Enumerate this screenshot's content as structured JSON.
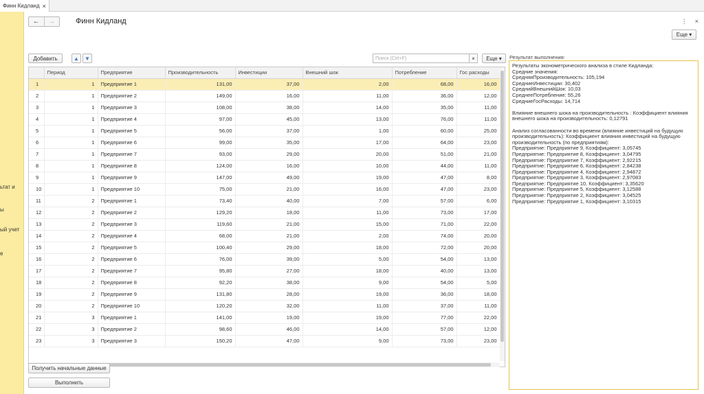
{
  "tab": {
    "title": "Финн Кидланд"
  },
  "left_panel": {
    "items": [
      "ьтат и",
      "ы",
      "ый учет",
      "е"
    ]
  },
  "header": {
    "title": "Финн Кидланд",
    "more_label": "Еще ▾",
    "kebab": "⋮",
    "close": "×"
  },
  "toolbar": {
    "add_label": "Добавить",
    "up_arrow": "▲",
    "down_arrow": "▼",
    "search_placeholder": "Поиск (Ctrl+F)",
    "search_clear": "×",
    "more_label": "Еще ▾"
  },
  "table": {
    "columns": [
      "",
      "Период",
      "Предприятие",
      "Производительность",
      "Инвестиции",
      "Внешний шок",
      "Потребление",
      "Гос расходы"
    ],
    "rows": [
      [
        "1",
        "1",
        "Предприятие 1",
        "131,00",
        "37,00",
        "2,00",
        "68,00",
        "16,00"
      ],
      [
        "2",
        "1",
        "Предприятие 2",
        "149,00",
        "16,00",
        "11,00",
        "36,00",
        "12,00"
      ],
      [
        "3",
        "1",
        "Предприятие 3",
        "108,00",
        "38,00",
        "14,00",
        "35,00",
        "11,00"
      ],
      [
        "4",
        "1",
        "Предприятие 4",
        "97,00",
        "45,00",
        "13,00",
        "76,00",
        "11,00"
      ],
      [
        "5",
        "1",
        "Предприятие 5",
        "56,00",
        "37,00",
        "1,00",
        "60,00",
        "25,00"
      ],
      [
        "6",
        "1",
        "Предприятие 6",
        "99,00",
        "35,00",
        "17,00",
        "64,00",
        "23,00"
      ],
      [
        "7",
        "1",
        "Предприятие 7",
        "93,00",
        "29,00",
        "20,00",
        "51,00",
        "21,00"
      ],
      [
        "8",
        "1",
        "Предприятие 8",
        "124,00",
        "16,00",
        "10,00",
        "44,00",
        "11,00"
      ],
      [
        "9",
        "1",
        "Предприятие 9",
        "147,00",
        "49,00",
        "19,00",
        "47,00",
        "8,00"
      ],
      [
        "10",
        "1",
        "Предприятие 10",
        "75,00",
        "21,00",
        "16,00",
        "47,00",
        "23,00"
      ],
      [
        "11",
        "2",
        "Предприятие 1",
        "73,40",
        "40,00",
        "7,00",
        "57,00",
        "6,00"
      ],
      [
        "12",
        "2",
        "Предприятие 2",
        "129,20",
        "18,00",
        "11,00",
        "73,00",
        "17,00"
      ],
      [
        "13",
        "2",
        "Предприятие 3",
        "119,60",
        "21,00",
        "15,00",
        "71,00",
        "22,00"
      ],
      [
        "14",
        "2",
        "Предприятие 4",
        "68,00",
        "21,00",
        "2,00",
        "74,00",
        "20,00"
      ],
      [
        "15",
        "2",
        "Предприятие 5",
        "100,40",
        "29,00",
        "18,00",
        "72,00",
        "20,00"
      ],
      [
        "16",
        "2",
        "Предприятие 6",
        "76,00",
        "39,00",
        "5,00",
        "54,00",
        "13,00"
      ],
      [
        "17",
        "2",
        "Предприятие 7",
        "95,80",
        "27,00",
        "18,00",
        "40,00",
        "13,00"
      ],
      [
        "18",
        "2",
        "Предприятие 8",
        "92,20",
        "38,00",
        "9,00",
        "54,00",
        "5,00"
      ],
      [
        "19",
        "2",
        "Предприятие 9",
        "131,80",
        "28,00",
        "19,00",
        "36,00",
        "18,00"
      ],
      [
        "20",
        "2",
        "Предприятие 10",
        "120,20",
        "32,00",
        "11,00",
        "37,00",
        "11,00"
      ],
      [
        "21",
        "3",
        "Предприятие 1",
        "141,00",
        "19,00",
        "19,00",
        "77,00",
        "22,00"
      ],
      [
        "22",
        "3",
        "Предприятие 2",
        "98,60",
        "46,00",
        "14,00",
        "57,00",
        "12,00"
      ],
      [
        "23",
        "3",
        "Предприятие 3",
        "150,20",
        "47,00",
        "9,00",
        "73,00",
        "23,00"
      ]
    ]
  },
  "buttons": {
    "get_data_label": "Получить начальные данные",
    "execute_label": "Выполнить"
  },
  "result": {
    "label": "Результат выполнения:",
    "lines": [
      "Результаты эконометрического анализа в стиле Кидланда:",
      "Средние значения:",
      "СредняяПроизводительность: 105,194",
      "СредниеИнвестиции: 30,402",
      "СреднийВнешнийШок: 10,03",
      "СреднееПотребление: 55,26",
      "СредниеГосРасходы: 14,714",
      "",
      "Влияние внешнего шока на производительность : Коэффициент влияния внешнего шока на производительность: 0,12791",
      "",
      "Анализ согласованности во времени (влияние инвестиций на будущую производительность): Коэффициент влияния инвестиций на будущую производительность (по предприятиям):",
      "Предприятие: Предприятие 9, Коэффициент: 3,05745",
      "Предприятие: Предприятие 8, Коэффициент: 3,04795",
      "Предприятие: Предприятие 7, Коэффициент: 2,92215",
      "Предприятие: Предприятие 6, Коэффициент: 2,84238",
      "Предприятие: Предприятие 4, Коэффициент: 2,94872",
      "Предприятие: Предприятие 3, Коэффициент: 2,97083",
      "Предприятие: Предприятие 10, Коэффициент: 3,35620",
      "Предприятие: Предприятие 5, Коэффициент: 3,12588",
      "Предприятие: Предприятие 2, Коэффициент: 3,04525",
      "Предприятие: Предприятие 1, Коэффициент: 3,10315"
    ]
  }
}
